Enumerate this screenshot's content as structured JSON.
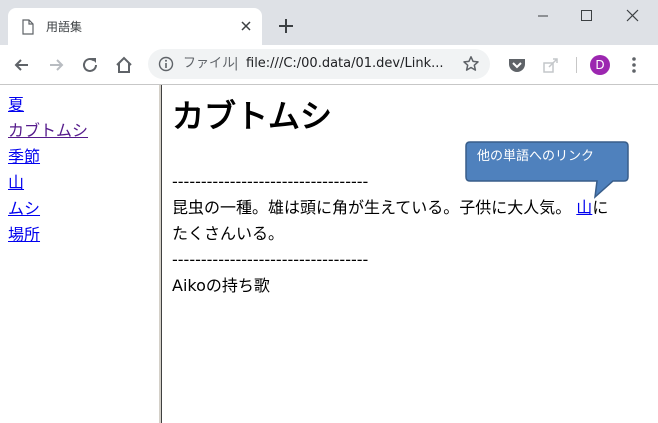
{
  "browser": {
    "tab_title": "用語集",
    "omnibox": {
      "security_label": "ファイル",
      "separator": "|",
      "url": "file:///C:/00.data/01.dev/Link..."
    },
    "profile_initial": "D",
    "colors": {
      "profile_avatar": "#9c27b0",
      "tabstrip": "#dee1e6",
      "omnibox_bg": "#f1f3f4"
    },
    "icons": [
      "document-icon",
      "close-icon",
      "plus-icon",
      "minimize-icon",
      "maximize-icon",
      "close-icon",
      "back-arrow-icon",
      "forward-arrow-icon",
      "reload-icon",
      "home-icon",
      "info-icon",
      "star-icon",
      "pocket-icon",
      "share-icon",
      "more-vertical-icon"
    ]
  },
  "nav": {
    "links": [
      {
        "label": "夏",
        "color": "#0000ee"
      },
      {
        "label": "カブトムシ",
        "color": "#551a8b"
      },
      {
        "label": "季節",
        "color": "#0000ee"
      },
      {
        "label": "山",
        "color": "#0000ee"
      },
      {
        "label": "ムシ",
        "color": "#0000ee"
      },
      {
        "label": "場所",
        "color": "#0000ee"
      }
    ]
  },
  "content": {
    "title": "カブトムシ",
    "separator": "----------------------------------",
    "description_before_link": "昆虫の一種。雄は頭に角が生えている。子供に大人気。 ",
    "description_link": "山",
    "description_after_link": "に",
    "description_line2": "たくさんいる。",
    "footer_text": "Aikoの持ち歌"
  },
  "callout": {
    "text": "他の単語へのリンク",
    "fill_color": "#4f81bd",
    "border_color": "#385d8a"
  }
}
